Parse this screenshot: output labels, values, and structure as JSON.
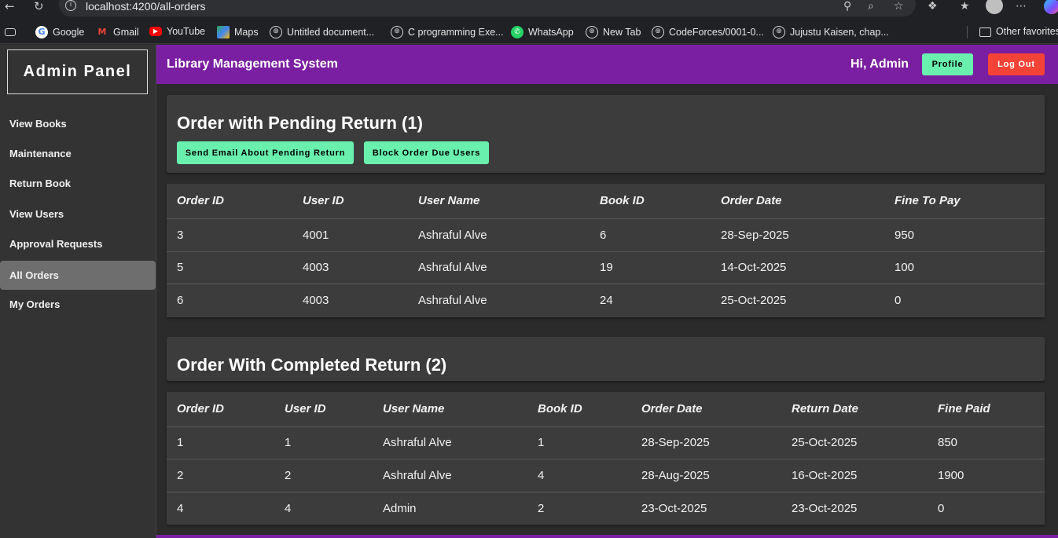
{
  "browser": {
    "url": "localhost:4200/all-orders",
    "bookmarks": [
      {
        "label": "Google",
        "icon": "google-icon"
      },
      {
        "label": "Gmail",
        "icon": "gmail-icon"
      },
      {
        "label": "YouTube",
        "icon": "youtube-icon"
      },
      {
        "label": "Maps",
        "icon": "maps-icon"
      },
      {
        "label": "Untitled document...",
        "icon": "globe-icon"
      },
      {
        "label": "C programming Exe...",
        "icon": "globe-icon"
      },
      {
        "label": "WhatsApp",
        "icon": "whatsapp-icon"
      },
      {
        "label": "New Tab",
        "icon": "globe-icon"
      },
      {
        "label": "CodeForces/0001-0...",
        "icon": "globe-icon"
      },
      {
        "label": "Jujustu Kaisen, chap...",
        "icon": "globe-icon"
      }
    ],
    "other_favorites": "Other favorites"
  },
  "sidebar": {
    "brand": "Admin Panel",
    "items": [
      {
        "label": "View Books"
      },
      {
        "label": "Maintenance"
      },
      {
        "label": "Return Book"
      },
      {
        "label": "View Users"
      },
      {
        "label": "Approval Requests"
      },
      {
        "label": "All Orders",
        "active": true
      },
      {
        "label": "My Orders"
      }
    ]
  },
  "header": {
    "title": "Library Management System",
    "greeting": "Hi, Admin",
    "profile_label": "Profile",
    "logout_label": "Log Out"
  },
  "pending": {
    "title": "Order with Pending Return (1)",
    "email_button": "Send Email About Pending Return",
    "block_button": "Block Order Due Users",
    "columns": [
      "Order ID",
      "User ID",
      "User Name",
      "Book ID",
      "Order Date",
      "Fine To Pay"
    ],
    "rows": [
      [
        "3",
        "4001",
        "Ashraful Alve",
        "6",
        "28-Sep-2025",
        "950"
      ],
      [
        "5",
        "4003",
        "Ashraful Alve",
        "19",
        "14-Oct-2025",
        "100"
      ],
      [
        "6",
        "4003",
        "Ashraful Alve",
        "24",
        "25-Oct-2025",
        "0"
      ]
    ]
  },
  "completed": {
    "title": "Order With Completed Return (2)",
    "columns": [
      "Order ID",
      "User ID",
      "User Name",
      "Book ID",
      "Order Date",
      "Return Date",
      "Fine Paid"
    ],
    "rows": [
      [
        "1",
        "1",
        "Ashraful Alve",
        "1",
        "28-Sep-2025",
        "25-Oct-2025",
        "850"
      ],
      [
        "2",
        "2",
        "Ashraful Alve",
        "4",
        "28-Aug-2025",
        "16-Oct-2025",
        "1900"
      ],
      [
        "4",
        "4",
        "Admin",
        "2",
        "23-Oct-2025",
        "23-Oct-2025",
        "0"
      ]
    ]
  },
  "colors": {
    "accent": "#7b1fa2",
    "button_green": "#69f0ae",
    "button_red": "#f44336"
  }
}
